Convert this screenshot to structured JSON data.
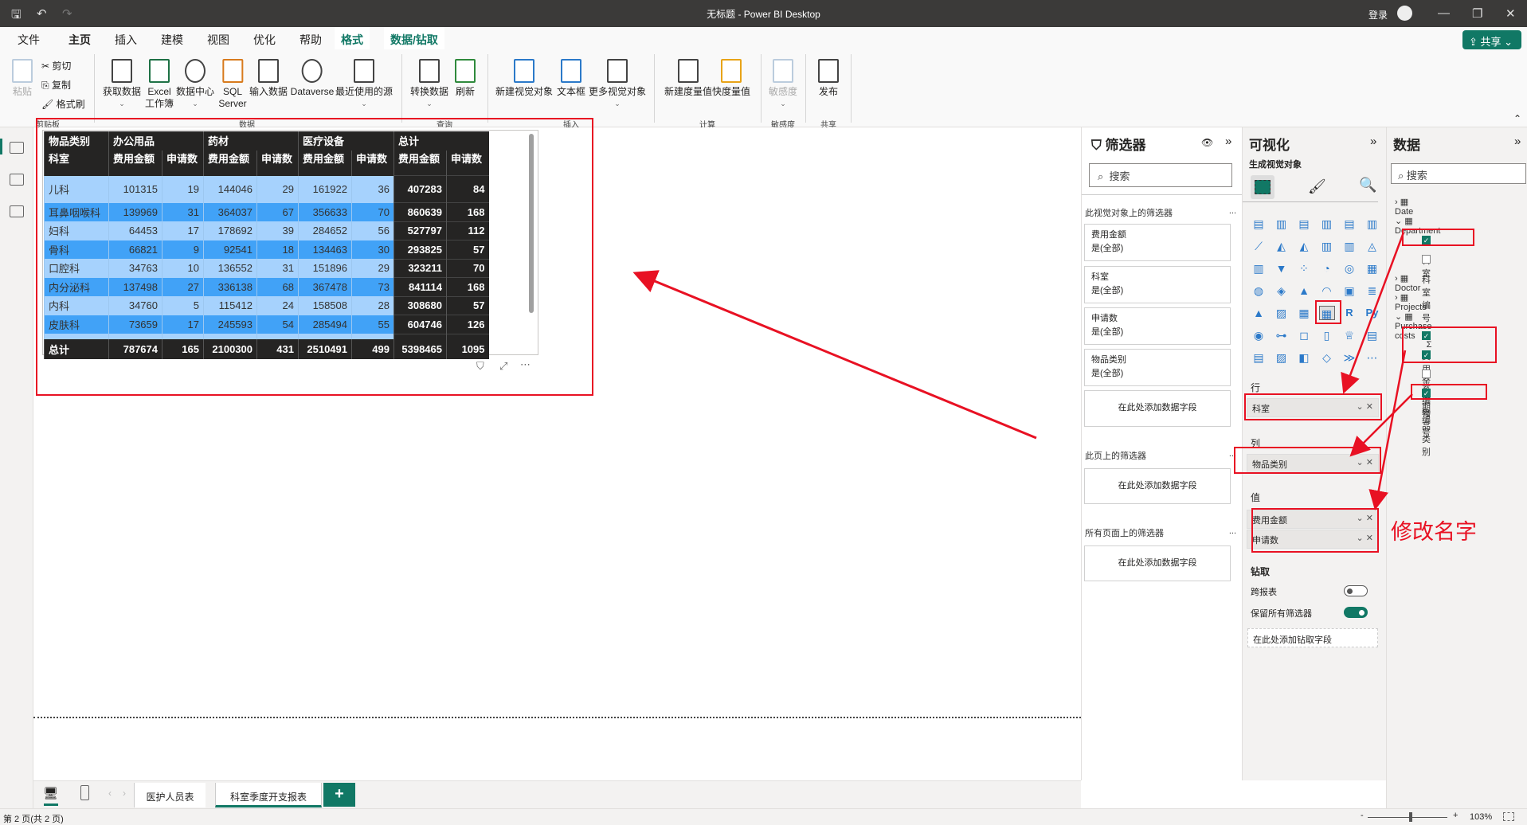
{
  "window": {
    "title": "无标题 - Power BI Desktop",
    "login": "登录"
  },
  "menu_tabs": [
    "文件",
    "主页",
    "插入",
    "建模",
    "视图",
    "优化",
    "帮助",
    "格式",
    "数据/钻取"
  ],
  "share": "共享",
  "ribbon": {
    "paste": "粘贴",
    "cut": "剪切",
    "copy": "复制",
    "format_painter": "格式刷",
    "get_data": "获取数据",
    "excel": "Excel",
    "excel2": "工作簿",
    "data_hub": "数据中心",
    "sql": "SQL",
    "sql2": "Server",
    "enter_data": "输入数据",
    "dataverse": "Dataverse",
    "recent": "最近使用的源",
    "transform": "转换数据",
    "refresh": "刷新",
    "new_visual": "新建视觉对象",
    "text_box": "文本框",
    "more_visuals": "更多视觉对象",
    "new_measure": "新建度量值",
    "quick_measure": "快度量值",
    "sensitivity": "敏感度",
    "publish": "发布",
    "groups": {
      "clipboard": "剪贴板",
      "data": "数据",
      "query": "查询",
      "insert": "插入",
      "calc": "计算",
      "sensitivity": "敏感度",
      "share": "共享"
    }
  },
  "matrix": {
    "col_group_header": "物品类别",
    "row_header": "科室",
    "groups": [
      "办公用品",
      "药材",
      "医疗设备",
      "总计"
    ],
    "measures": [
      "费用金额",
      "申请数"
    ],
    "rows": [
      {
        "name": "儿科",
        "v": [
          101315,
          19,
          144046,
          29,
          161922,
          36,
          407283,
          84
        ]
      },
      {
        "name": "耳鼻咽喉科",
        "v": [
          139969,
          31,
          364037,
          67,
          356633,
          70,
          860639,
          168
        ]
      },
      {
        "name": "妇科",
        "v": [
          64453,
          17,
          178692,
          39,
          284652,
          56,
          527797,
          112
        ]
      },
      {
        "name": "骨科",
        "v": [
          66821,
          9,
          92541,
          18,
          134463,
          30,
          293825,
          57
        ]
      },
      {
        "name": "口腔科",
        "v": [
          34763,
          10,
          136552,
          31,
          151896,
          29,
          323211,
          70
        ]
      },
      {
        "name": "内分泌科",
        "v": [
          137498,
          27,
          336138,
          68,
          367478,
          73,
          841114,
          168
        ]
      },
      {
        "name": "内科",
        "v": [
          34760,
          5,
          115412,
          24,
          158508,
          28,
          308680,
          57
        ]
      },
      {
        "name": "皮肤科",
        "v": [
          73659,
          17,
          245593,
          54,
          285494,
          55,
          604746,
          126
        ]
      }
    ],
    "total_label": "总计",
    "totals": [
      787674,
      165,
      2100300,
      431,
      2510491,
      499,
      5398465,
      1095
    ]
  },
  "filters": {
    "title": "筛选器",
    "search": "搜索",
    "visual_section": "此视觉对象上的筛选器",
    "cards": [
      {
        "field": "费用金额",
        "state": "是(全部)"
      },
      {
        "field": "科室",
        "state": "是(全部)"
      },
      {
        "field": "申请数",
        "state": "是(全部)"
      },
      {
        "field": "物品类别",
        "state": "是(全部)"
      }
    ],
    "add": "在此处添加数据字段",
    "page_section": "此页上的筛选器",
    "all_section": "所有页面上的筛选器",
    "more": "..."
  },
  "viz": {
    "title": "可视化",
    "build": "生成视觉对象",
    "icons": [
      "stacked-bar",
      "stacked-column",
      "clustered-bar",
      "clustered-column",
      "100-bar",
      "100-column",
      "line",
      "area",
      "stacked-area",
      "line-column",
      "line-clustered",
      "ribbon",
      "waterfall",
      "funnel",
      "scatter",
      "pie",
      "donut",
      "treemap",
      "map",
      "filled-map",
      "azure-map",
      "gauge",
      "card",
      "multi-row-card",
      "kpi",
      "slicer",
      "table",
      "matrix",
      "r-visual",
      "python-visual",
      "key-influencers",
      "decomposition-tree",
      "qa",
      "paginated",
      "goals",
      "report",
      "smart-narrative",
      "filter-card",
      "arcgis",
      "power-apps",
      "power-automate",
      "more"
    ],
    "rows_label": "行",
    "rows_field": "科室",
    "cols_label": "列",
    "cols_field": "物品类别",
    "values_label": "值",
    "values": [
      "费用金额",
      "申请数"
    ],
    "drill": "钻取",
    "cross_report": "跨报表",
    "cross_report_on": false,
    "keep_filters": "保留所有筛选器",
    "keep_filters_on": true,
    "add_drill": "在此处添加钻取字段"
  },
  "data": {
    "title": "数据",
    "search": "搜索",
    "tables": [
      {
        "name": "Date",
        "expanded": false
      },
      {
        "name": "Department",
        "expanded": true,
        "fields": [
          {
            "name": "科室",
            "checked": true
          },
          {
            "name": "科室编号",
            "checked": false
          }
        ]
      },
      {
        "name": "Doctor",
        "expanded": false
      },
      {
        "name": "Projects",
        "expanded": false
      },
      {
        "name": "Purchase costs",
        "expanded": true,
        "fields": [
          {
            "name": "费用金额",
            "checked": true,
            "sigma": "Σ"
          },
          {
            "name": "科室编号",
            "checked": true
          },
          {
            "name": "日期编号",
            "checked": false
          },
          {
            "name": "物品类别",
            "checked": true
          }
        ]
      }
    ]
  },
  "annotation": "修改名字",
  "pages": [
    "医护人员表",
    "科室季度开支报表"
  ],
  "status": {
    "page": "第 2 页(共 2 页)",
    "zoom": "103%",
    "zoom_level": 103
  },
  "colors": {
    "accent": "#117865",
    "light_row": "#a6d2fd",
    "dark_row": "#41a2f7",
    "header": "#252423",
    "annotation": "#e81123"
  }
}
